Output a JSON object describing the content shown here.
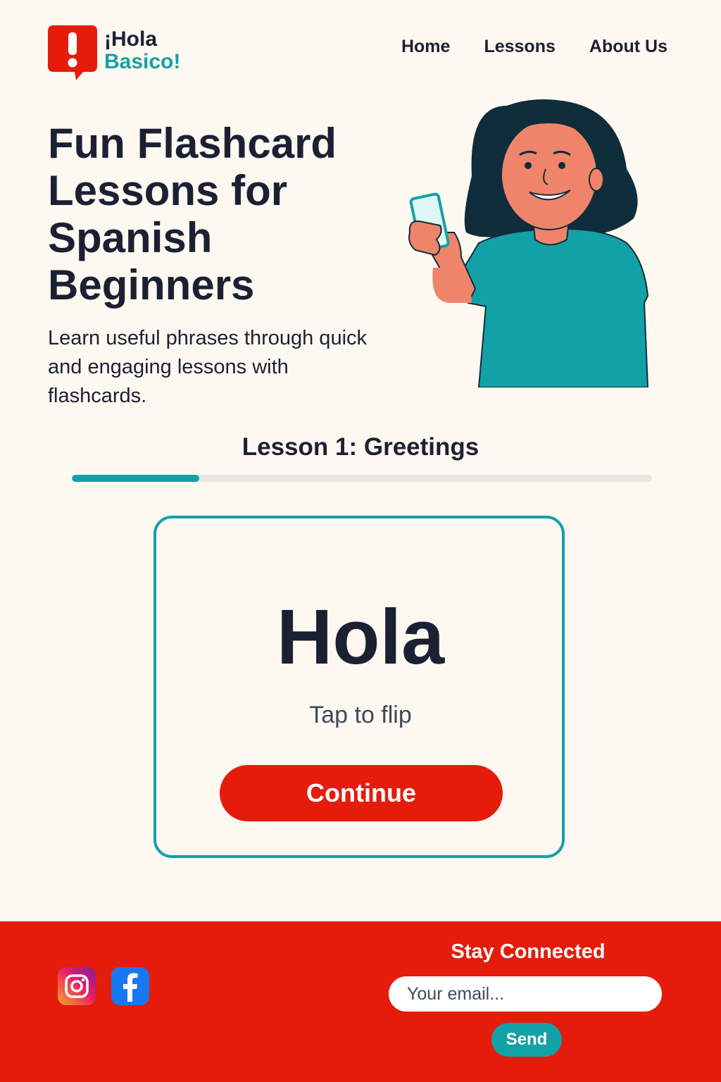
{
  "brand": {
    "line1": "¡Hola",
    "line2": "Basico!",
    "logo_icon": "exclamation-bubble-icon",
    "logo_color": "#e51c0c",
    "accent": "#13a1a8"
  },
  "nav": {
    "items": [
      {
        "label": "Home"
      },
      {
        "label": "Lessons"
      },
      {
        "label": "About Us"
      }
    ]
  },
  "hero": {
    "title": "Fun Flashcard Lessons for Spanish Beginners",
    "subtitle": "Learn useful phrases through quick and engaging lessons with flashcards.",
    "illustration": "woman-holding-flashcard"
  },
  "lesson": {
    "title": "Lesson 1: Greetings",
    "progress": 0.22
  },
  "flashcard": {
    "word": "Hola",
    "hint": "Tap to flip",
    "continue_label": "Continue"
  },
  "footer": {
    "social": [
      {
        "icon": "instagram-icon"
      },
      {
        "icon": "facebook-icon"
      }
    ],
    "stay_title": "Stay Connected",
    "email_placeholder": "Your email...",
    "send_label": "Send",
    "background": "#e51c0c"
  }
}
